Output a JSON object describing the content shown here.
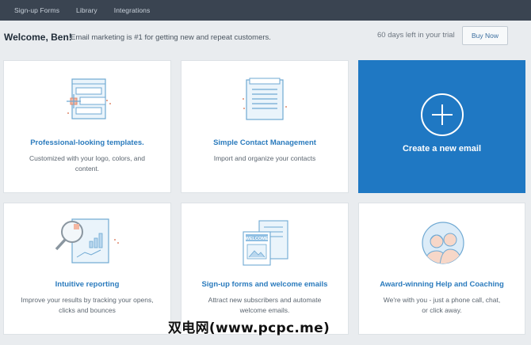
{
  "nav": {
    "items": [
      "Sign-up Forms",
      "Library",
      "Integrations"
    ]
  },
  "welcome": {
    "greeting": "Welcome, Ben!",
    "tagline": "Email marketing is #1 for getting new and repeat customers.",
    "trial_text": "60 days left in your trial",
    "buy_label": "Buy Now"
  },
  "cards": [
    {
      "title": "Professional-looking templates.",
      "desc": "Customized with your logo, colors, and content.",
      "icon": "template-icon"
    },
    {
      "title": "Simple Contact Management",
      "desc": "Import and organize your contacts",
      "icon": "contacts-icon"
    },
    {
      "title": "Create a new email",
      "icon": "plus-circle-icon"
    },
    {
      "title": "Intuitive reporting",
      "desc": "Improve your results by tracking your opens, clicks and bounces",
      "icon": "reporting-icon"
    },
    {
      "title": "Sign-up forms and welcome emails",
      "desc": "Attract new subscribers and automate welcome emails.",
      "icon": "signup-form-icon",
      "icon_text": "WELCOME"
    },
    {
      "title": "Award-winning Help and Coaching",
      "desc": "We're with you - just a phone call, chat, or click away.",
      "icon": "support-people-icon"
    }
  ],
  "watermark": "双电网(www.pcpc.me)",
  "colors": {
    "nav_bg": "#3a4451",
    "page_bg": "#e9ecef",
    "accent": "#1f78c3",
    "title_blue": "#2b7bbd"
  }
}
